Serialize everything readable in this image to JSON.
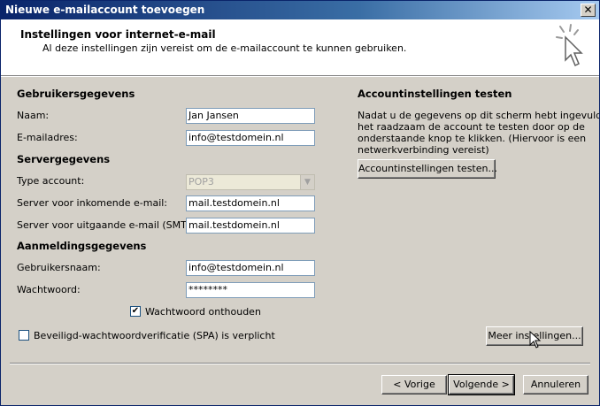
{
  "window": {
    "title": "Nieuwe e-mailaccount toevoegen",
    "close_symbol": "✕"
  },
  "header": {
    "title": "Instellingen voor internet-e-mail",
    "subtitle": "Al deze instellingen zijn vereist om de e-mailaccount te kunnen gebruiken."
  },
  "user_info": {
    "heading": "Gebruikersgegevens",
    "name_label": "Naam:",
    "name_value": "Jan Jansen",
    "email_label": "E-mailadres:",
    "email_value": "info@testdomein.nl"
  },
  "server_info": {
    "heading": "Servergegevens",
    "account_type_label": "Type account:",
    "account_type_value": "POP3",
    "incoming_label": "Server voor inkomende e-mail:",
    "incoming_value": "mail.testdomein.nl",
    "outgoing_label": "Server voor uitgaande e-mail (SMTP):",
    "outgoing_value": "mail.testdomein.nl"
  },
  "logon_info": {
    "heading": "Aanmeldingsgegevens",
    "username_label": "Gebruikersnaam:",
    "username_value": "info@testdomein.nl",
    "password_label": "Wachtwoord:",
    "password_value": "********",
    "remember_label": "Wachtwoord onthouden",
    "remember_checked": true,
    "spa_label": "Beveiligd-wachtwoordverificatie (SPA) is verplicht",
    "spa_checked": false
  },
  "test": {
    "heading": "Accountinstellingen testen",
    "description_line1": "Nadat u de gegevens op dit scherm hebt ingevuld, is",
    "description_line2": "het raadzaam de account te testen door op de",
    "description_line3": "onderstaande knop te klikken. (Hiervoor is een",
    "description_line4": "netwerkverbinding vereist)",
    "button_label": "Accountinstellingen testen..."
  },
  "more_settings_label": "Meer instellingen...",
  "nav": {
    "back_label": "< Vorige",
    "next_label": "Volgende >",
    "cancel_label": "Annuleren"
  },
  "checkmark": "✔"
}
